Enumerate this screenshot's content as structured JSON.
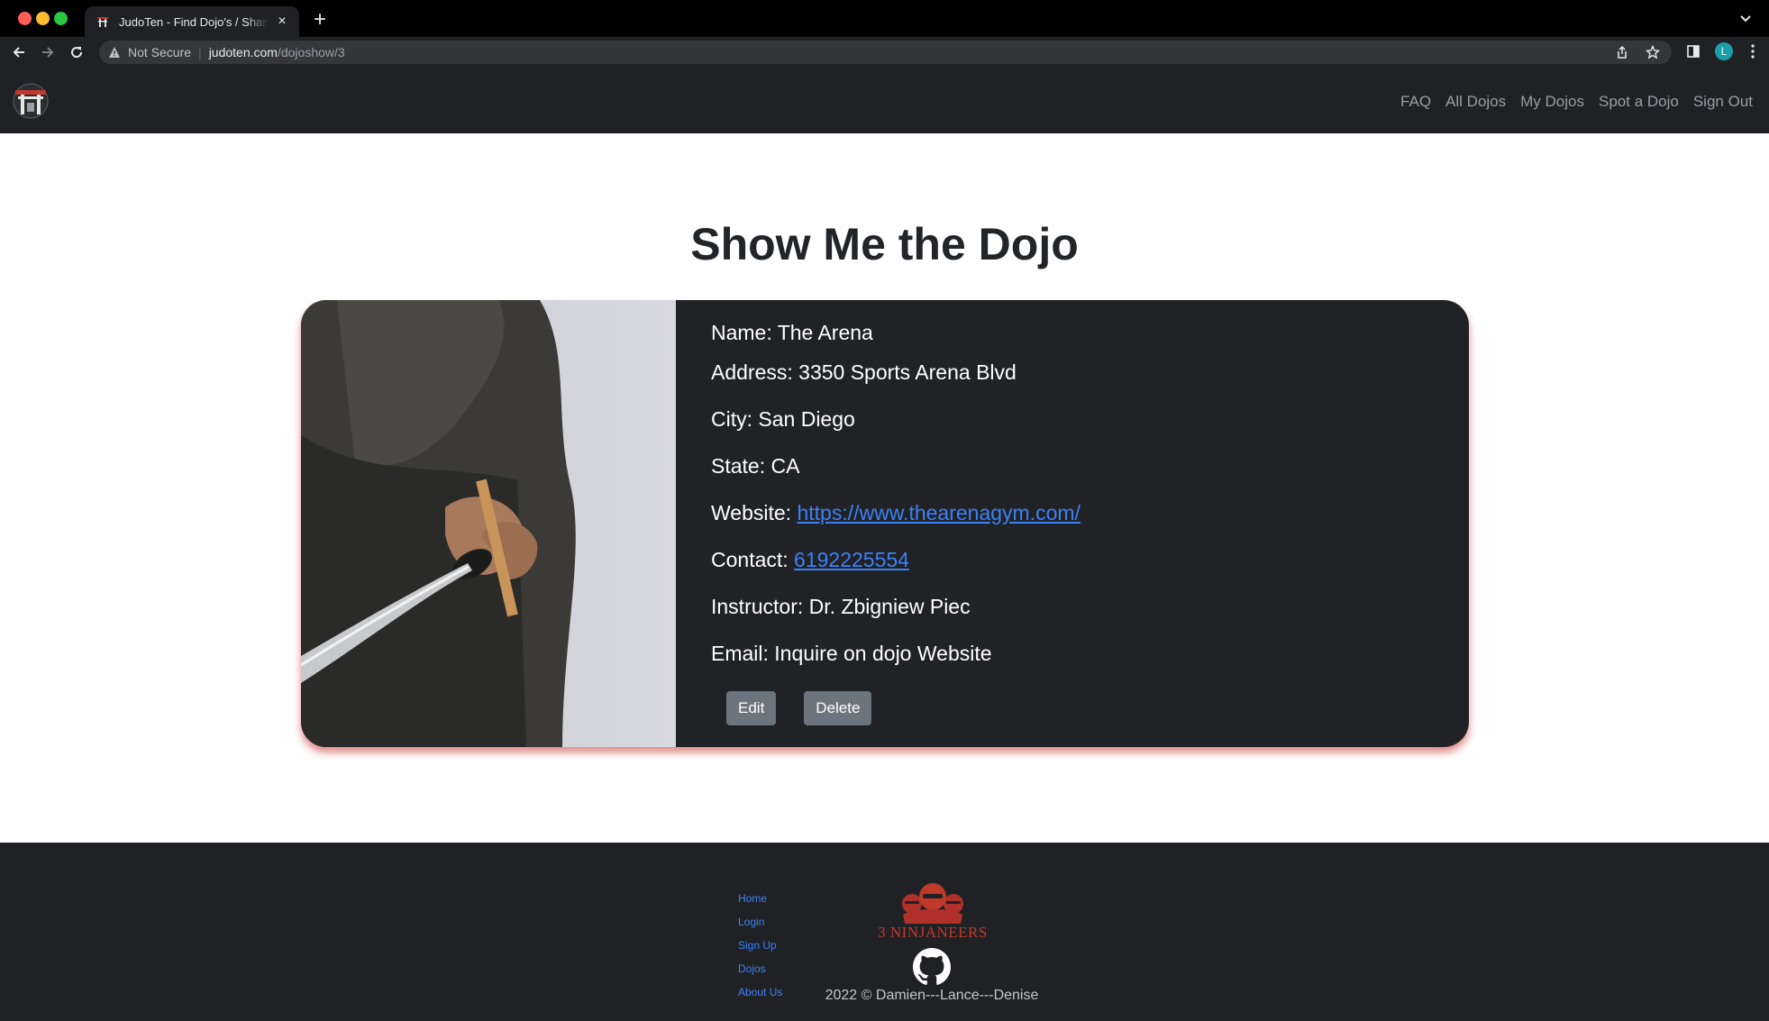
{
  "browser": {
    "tab_title": "JudoTen - Find Dojo's / Share Dojo's",
    "security_label": "Not Secure",
    "url_host": "judoten.com",
    "url_path": "/dojoshow/3",
    "profile_initial": "L"
  },
  "nav": {
    "links": [
      "FAQ",
      "All Dojos",
      "My Dojos",
      "Spot a Dojo",
      "Sign Out"
    ]
  },
  "page": {
    "title": "Show Me the Dojo"
  },
  "dojo": {
    "name": "Name: The Arena",
    "address": "Address: 3350 Sports Arena Blvd",
    "city": "City: San Diego",
    "state": "State: CA",
    "website_label": "Website:",
    "website_url": "https://www.thearenagym.com/",
    "contact_label": "Contact:",
    "contact_phone": "6192225554",
    "instructor": "Instructor: Dr. Zbigniew Piec",
    "email": "Email: Inquire on dojo Website"
  },
  "actions": {
    "edit": "Edit",
    "delete": "Delete"
  },
  "footer": {
    "links": [
      "Home",
      "Login",
      "Sign Up",
      "Dojos",
      "About Us"
    ],
    "brand": "3 NINJANEERS",
    "copyright": "2022 © Damien---Lance---Denise"
  },
  "colors": {
    "nav_bg": "#202125",
    "card_bg": "#212226",
    "link_blue": "#3b82f6",
    "button_gray": "#6c757d",
    "brand_red": "#c0392b"
  },
  "icons": [
    "warning-icon",
    "back-icon",
    "forward-icon",
    "reload-icon",
    "share-icon",
    "star-icon",
    "sidepanel-icon",
    "menu-icon",
    "github-icon",
    "torii-logo-icon",
    "ninja-logo-icon"
  ]
}
